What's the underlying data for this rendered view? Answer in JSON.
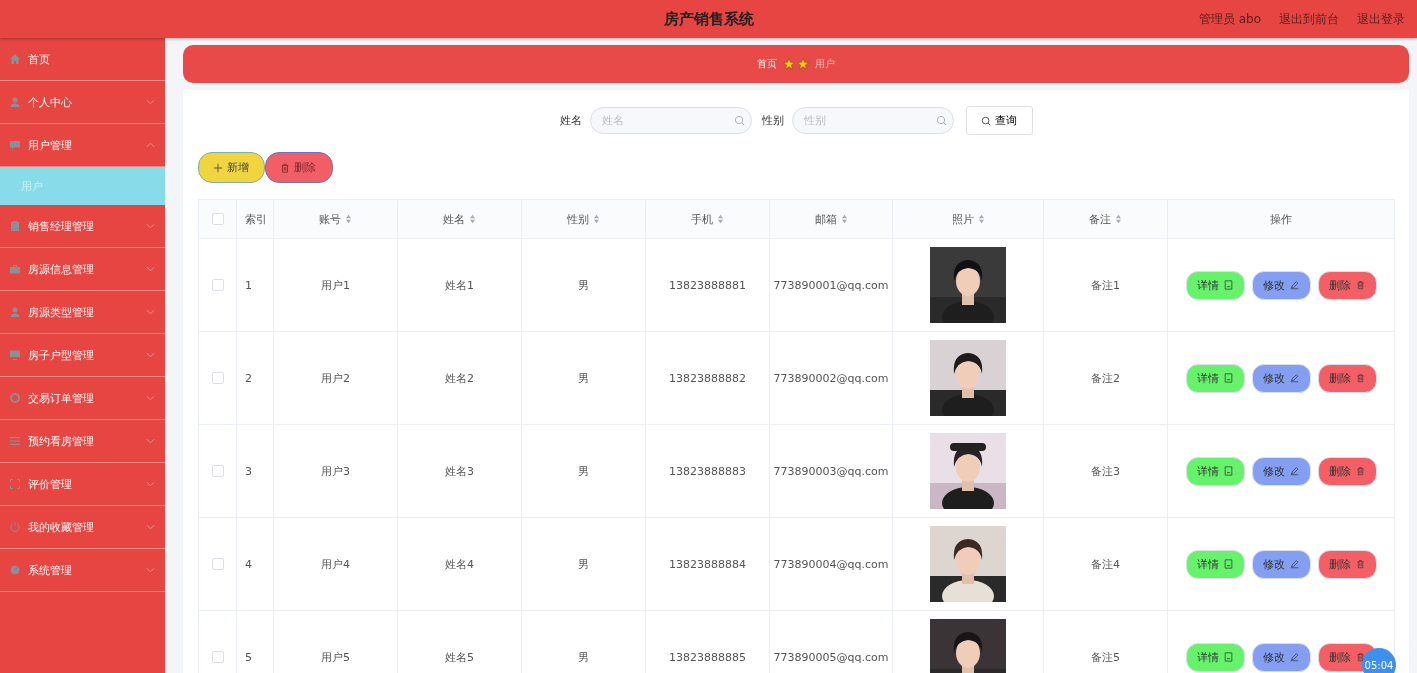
{
  "header": {
    "title": "房产销售系统",
    "user": "管理员 abo",
    "links": [
      "退出到前台",
      "退出登录"
    ]
  },
  "sidebar": {
    "items": [
      {
        "label": "首页"
      },
      {
        "label": "个人中心",
        "expanded": false
      },
      {
        "label": "用户管理",
        "expanded": true,
        "children": [
          {
            "label": "用户",
            "selected": true
          }
        ]
      },
      {
        "label": "销售经理管理",
        "expanded": false
      },
      {
        "label": "房源信息管理",
        "expanded": false
      },
      {
        "label": "房源类型管理",
        "expanded": false
      },
      {
        "label": "房子户型管理",
        "expanded": false
      },
      {
        "label": "交易订单管理",
        "expanded": false
      },
      {
        "label": "预约看房管理",
        "expanded": false
      },
      {
        "label": "评价管理",
        "expanded": false
      },
      {
        "label": "我的收藏管理",
        "expanded": false
      },
      {
        "label": "系统管理",
        "expanded": false
      }
    ]
  },
  "breadcrumb": [
    "首页",
    "用户"
  ],
  "search": {
    "fields": [
      {
        "label": "姓名",
        "placeholder": "姓名"
      },
      {
        "label": "性别",
        "placeholder": "性别"
      }
    ],
    "button": "查询"
  },
  "actions": [
    {
      "kind": "add",
      "label": "新增"
    },
    {
      "kind": "delete",
      "label": "删除"
    }
  ],
  "table": {
    "columns": [
      {
        "label": "索引",
        "kind": "plain"
      },
      {
        "label": "账号",
        "kind": "sortable"
      },
      {
        "label": "姓名",
        "kind": "sortable"
      },
      {
        "label": "性别",
        "kind": "sortable"
      },
      {
        "label": "手机",
        "kind": "sortable"
      },
      {
        "label": "邮箱",
        "kind": "sortable"
      },
      {
        "label": "照片",
        "kind": "sortable"
      },
      {
        "label": "备注",
        "kind": "sortable"
      },
      {
        "label": "操作",
        "kind": "plain"
      }
    ],
    "all_checked": false,
    "rows": [
      {
        "checked": false,
        "cells": [
          "1",
          "用户1",
          "姓名1",
          "男",
          "13823888881",
          "773890001@qq.com"
        ],
        "note": "备注1",
        "buttons": [
          {
            "kind": "detail",
            "label": "详情"
          },
          {
            "kind": "edit",
            "label": "修改"
          },
          {
            "kind": "delete",
            "label": "删除"
          }
        ]
      },
      {
        "checked": false,
        "cells": [
          "2",
          "用户2",
          "姓名2",
          "男",
          "13823888882",
          "773890002@qq.com"
        ],
        "note": "备注2",
        "buttons": [
          {
            "kind": "detail",
            "label": "详情"
          },
          {
            "kind": "edit",
            "label": "修改"
          },
          {
            "kind": "delete",
            "label": "删除"
          }
        ]
      },
      {
        "checked": false,
        "cells": [
          "3",
          "用户3",
          "姓名3",
          "男",
          "13823888883",
          "773890003@qq.com"
        ],
        "note": "备注3",
        "buttons": [
          {
            "kind": "detail",
            "label": "详情"
          },
          {
            "kind": "edit",
            "label": "修改"
          },
          {
            "kind": "delete",
            "label": "删除"
          }
        ]
      },
      {
        "checked": false,
        "cells": [
          "4",
          "用户4",
          "姓名4",
          "男",
          "13823888884",
          "773890004@qq.com"
        ],
        "note": "备注4",
        "buttons": [
          {
            "kind": "detail",
            "label": "详情"
          },
          {
            "kind": "edit",
            "label": "修改"
          },
          {
            "kind": "delete",
            "label": "删除"
          }
        ]
      },
      {
        "checked": false,
        "cells": [
          "5",
          "用户5",
          "姓名5",
          "男",
          "13823888885",
          "773890005@qq.com"
        ],
        "note": "备注5",
        "buttons": [
          {
            "kind": "detail",
            "label": "详情"
          },
          {
            "kind": "edit",
            "label": "修改"
          },
          {
            "kind": "delete",
            "label": "删除"
          }
        ]
      }
    ]
  },
  "recorder_timer": "05:04"
}
